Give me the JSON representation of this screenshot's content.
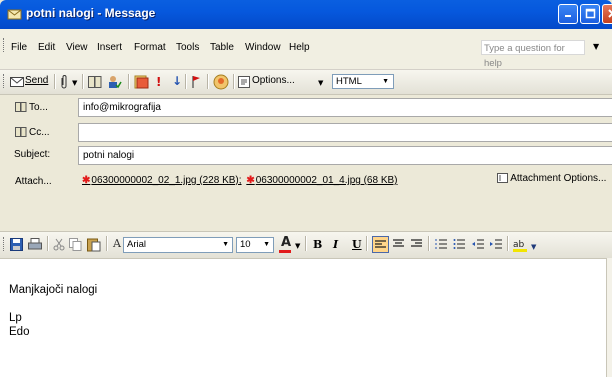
{
  "window": {
    "title": "potni nalogi - Message",
    "icon": "envelope-icon"
  },
  "menu": {
    "items": [
      "File",
      "Edit",
      "View",
      "Insert",
      "Format",
      "Tools",
      "Table",
      "Window",
      "Help"
    ],
    "question_placeholder": "Type a question for help"
  },
  "standard_toolbar": {
    "send_label": "Send",
    "options_label": "Options...",
    "format_value": "HTML"
  },
  "header": {
    "to_label": "To...",
    "to_value": "info@mikrografija",
    "cc_label": "Cc...",
    "cc_value": "",
    "subject_label": "Subject:",
    "subject_value": "potni nalogi",
    "attach_label": "Attach...",
    "attachments": [
      "06300000002_02_1.jpg (228 KB);",
      "06300000002_01_4.jpg (68 KB)"
    ],
    "attachment_options_label": "Attachment Options..."
  },
  "formatting_toolbar": {
    "font_name": "Arial",
    "font_size": "10",
    "bold": "B",
    "italic": "I",
    "underline": "U"
  },
  "message_body": {
    "lines": [
      "Manjkajoči nalogi",
      "",
      "Lp",
      "Edo"
    ]
  },
  "colors": {
    "titlebar": "#0658dd",
    "attachment_stamp": "#e21b1b",
    "active_button": "#ffd58a"
  }
}
